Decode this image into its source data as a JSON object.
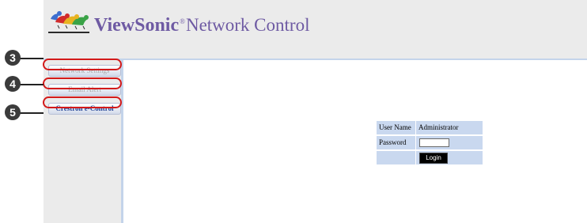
{
  "header": {
    "brand_name": "ViewSonic",
    "brand_mark": "®",
    "product_name": "Network Control",
    "logo_icon": "viewsonic-birds-logo"
  },
  "sidebar": {
    "items": [
      {
        "label": "Network Settings",
        "state": "disabled"
      },
      {
        "label": "Email Alert",
        "state": "disabled"
      },
      {
        "label": "Crestron e-Control",
        "state": "active"
      }
    ]
  },
  "callouts": [
    {
      "number": "3"
    },
    {
      "number": "4"
    },
    {
      "number": "5"
    }
  ],
  "login": {
    "user_name_label": "User Name",
    "user_name_value": "Administrator",
    "password_label": "Password",
    "password_value": "",
    "login_button": "Login"
  },
  "colors": {
    "brand_purple": "#6e5aa3",
    "callout_red": "#d31a1a",
    "form_cell_blue": "#c9d8ef",
    "panel_gray": "#ebebeb"
  }
}
